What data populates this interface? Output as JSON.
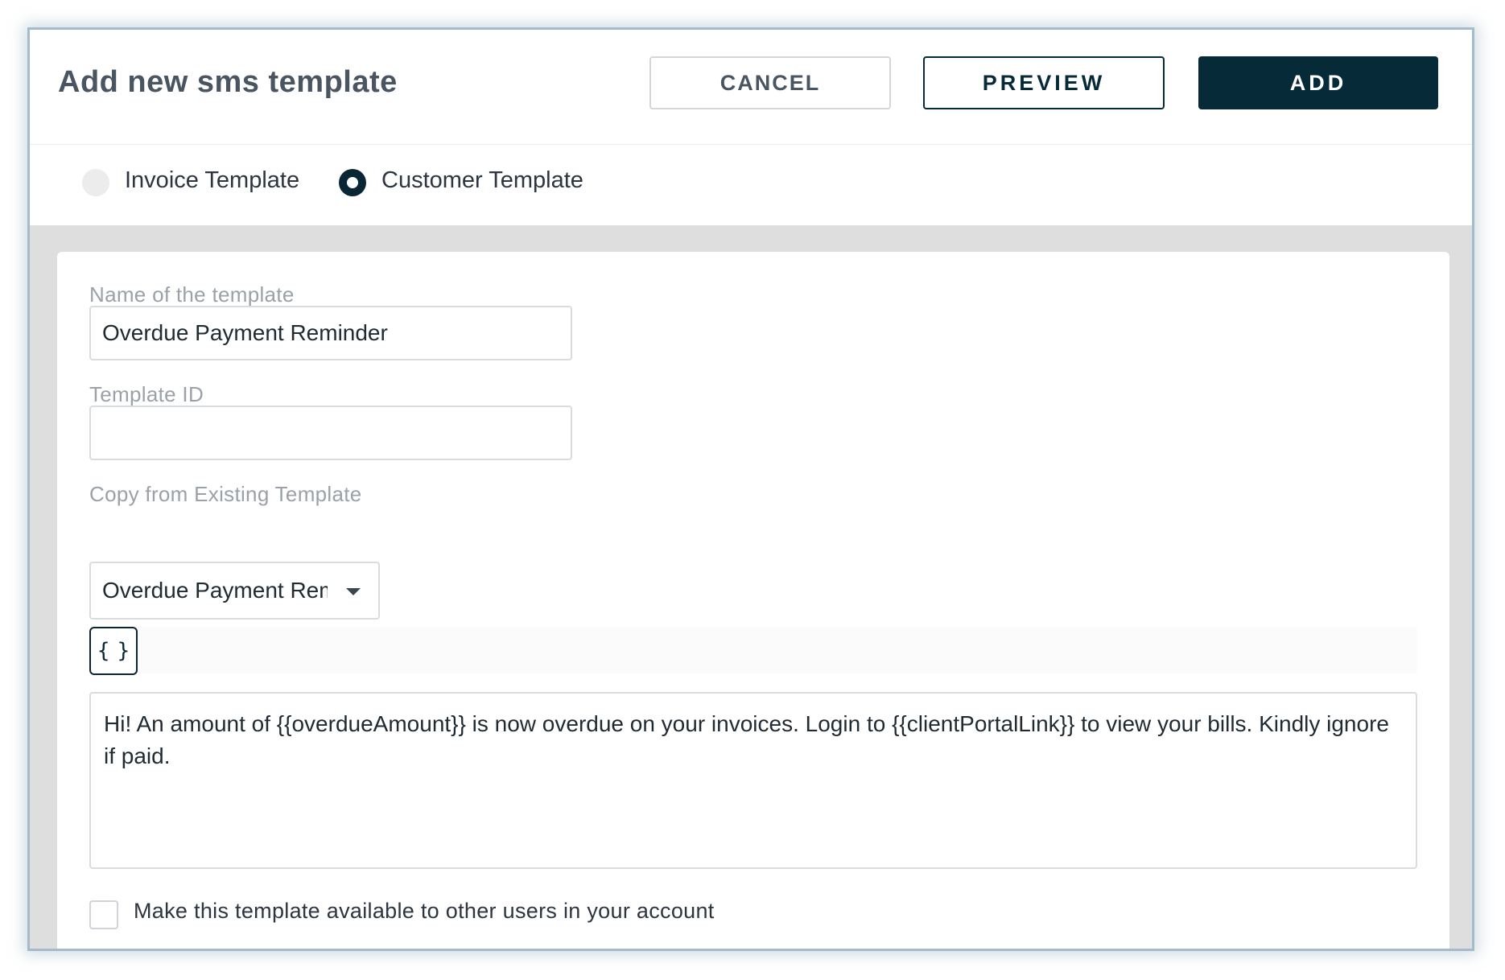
{
  "dialog": {
    "title": "Add new sms template",
    "buttons": {
      "cancel": "CANCEL",
      "preview": "PREVIEW",
      "add": "ADD"
    }
  },
  "template_type": {
    "options": [
      {
        "label": "Invoice Template",
        "selected": false
      },
      {
        "label": "Customer Template",
        "selected": true
      }
    ]
  },
  "form": {
    "name_label": "Name of the template",
    "name_value": "Overdue Payment Reminder",
    "template_id_label": "Template ID",
    "template_id_value": "",
    "copy_label": "Copy from Existing Template",
    "copy_value": "Overdue Payment Reminder",
    "variable_button": "{ }",
    "message": "Hi! An amount of {{overdueAmount}} is now overdue on your invoices. Login to {{clientPortalLink}} to view your bills. Kindly ignore if paid.",
    "share_label": "Make this template available to other users in your account",
    "share_checked": false
  },
  "colors": {
    "primary": "#062a38",
    "border": "#a3bccb",
    "background_grey": "#dedede",
    "label_grey": "#9aa1a8"
  }
}
